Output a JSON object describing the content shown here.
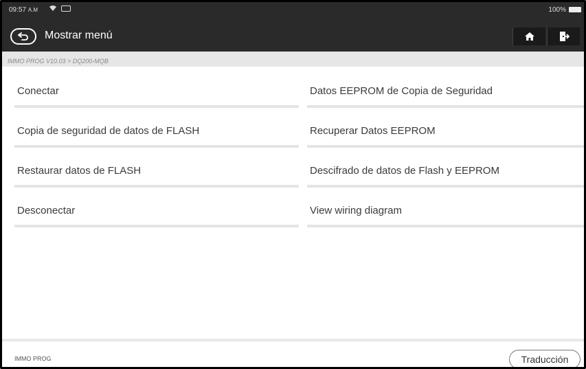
{
  "status_bar": {
    "time": "09:57",
    "ampm": "A.M",
    "battery": "100%"
  },
  "header": {
    "title": "Mostrar menú",
    "icons": {
      "back": "back-arrow-icon",
      "home": "home-icon",
      "exit": "exit-icon"
    }
  },
  "breadcrumb": "IMMO PROG V10.03 > DQ200-MQB",
  "menu": {
    "items": [
      "Conectar",
      "Datos EEPROM de Copia de Seguridad",
      "Copia de seguridad de datos de FLASH",
      "Recuperar Datos EEPROM",
      "Restaurar datos de FLASH",
      "Descifrado de datos de Flash y EEPROM",
      "Desconectar",
      "View wiring diagram"
    ]
  },
  "footer": {
    "app_label": "IMMO PROG",
    "translate_label": "Traducción"
  },
  "colors": {
    "topbar": "#2a2a2a",
    "breadcrumb_bg": "#e6e6e6",
    "divider": "#e4e4e4"
  }
}
